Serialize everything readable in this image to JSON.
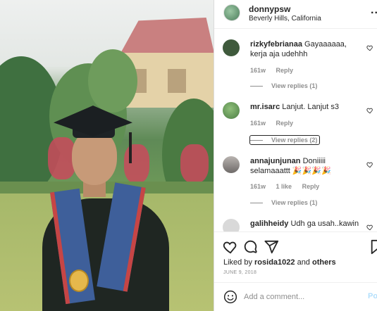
{
  "post": {
    "username": "donnypsw",
    "location": "Beverly Hills, California",
    "more_label": "..."
  },
  "comments": [
    {
      "username": "rizkyfebrianaa",
      "text": "Gayaaaaaa, kerja aja udehhh",
      "age": "161w",
      "likes": "",
      "reply_label": "Reply",
      "view_replies": "View replies (1)",
      "avatar_color": "#3f5a3c"
    },
    {
      "username": "mr.isarc",
      "text": "Lanjut. Lanjut s3",
      "age": "161w",
      "likes": "",
      "reply_label": "Reply",
      "view_replies": "View replies (2)",
      "avatar_color": "#5b8a4e"
    },
    {
      "username": "annajunjunan",
      "text": "Doniiiii selamaaattt 🎉🎉🎉🎉",
      "age": "161w",
      "likes": "1 like",
      "reply_label": "Reply",
      "view_replies": "View replies (1)",
      "avatar_color": "#8a8585"
    },
    {
      "username": "galihheidy",
      "text": "Udh ga usah..kawin",
      "age": "",
      "likes": "",
      "reply_label": "",
      "view_replies": "",
      "avatar_color": "#d9d9d9"
    }
  ],
  "actions": {
    "likes_prefix": "Liked by ",
    "likes_user": "rosida1022",
    "likes_middle": " and ",
    "likes_others": "others",
    "date": "JUNE 9, 2018"
  },
  "add_comment": {
    "placeholder": "Add a comment...",
    "post_label": "Po"
  },
  "colors": {
    "secondary_text": "#8e8e8e",
    "post_button": "#b2dffc",
    "border": "#dbdbdb"
  }
}
